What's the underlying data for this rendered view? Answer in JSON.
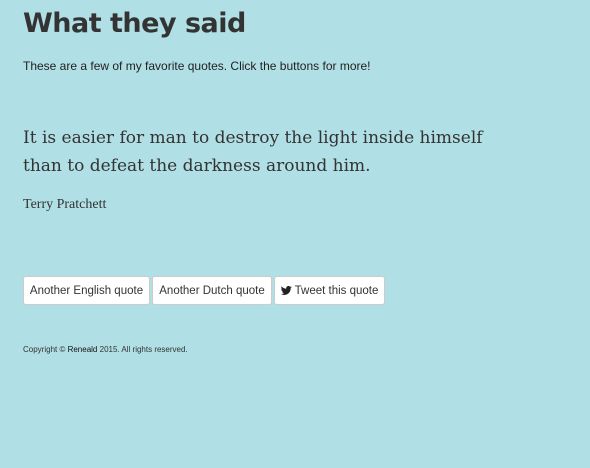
{
  "header": {
    "title": "What they said",
    "subtitle": "These are a few of my favorite quotes. Click the buttons for more!"
  },
  "quote": {
    "text": "It is easier for man to destroy the light inside himself than to defeat the darkness around him.",
    "author": "Terry Pratchett"
  },
  "buttons": {
    "english_label": "Another English quote",
    "dutch_label": "Another Dutch quote",
    "tweet_label": "Tweet this quote",
    "tweet_icon": "twitter-icon"
  },
  "footer": {
    "prefix": "Copyright © ",
    "link_text": "Reneald",
    "suffix": " 2015. All rights reserved."
  },
  "colors": {
    "background": "#b0dfe5",
    "text": "#333333",
    "button_bg": "#ffffff",
    "button_border": "#cccccc"
  }
}
